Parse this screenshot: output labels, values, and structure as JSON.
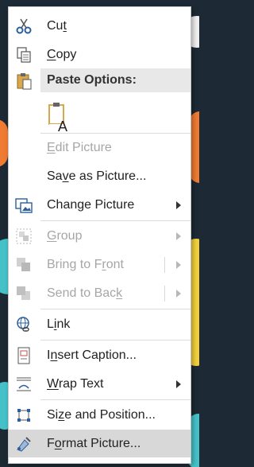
{
  "menu": {
    "items": [
      {
        "pre": "Cu",
        "ul": "t",
        "post": ""
      },
      {
        "pre": "",
        "ul": "C",
        "post": "opy"
      },
      {
        "header": "Paste Options:"
      },
      {
        "pre": "",
        "ul": "E",
        "post": "dit Picture"
      },
      {
        "pre": "Sa",
        "ul": "v",
        "post": "e as Picture..."
      },
      {
        "pre": "Change Picture",
        "ul": "",
        "post": ""
      },
      {
        "pre": "",
        "ul": "G",
        "post": "roup"
      },
      {
        "pre": "Bring to F",
        "ul": "r",
        "post": "ont"
      },
      {
        "pre": "Send to Bac",
        "ul": "k",
        "post": ""
      },
      {
        "pre": "L",
        "ul": "i",
        "post": "nk"
      },
      {
        "pre": "I",
        "ul": "n",
        "post": "sert Caption..."
      },
      {
        "pre": "",
        "ul": "W",
        "post": "rap Text"
      },
      {
        "pre": "Si",
        "ul": "z",
        "post": "e and Position..."
      },
      {
        "pre": "F",
        "ul": "o",
        "post": "rmat Picture..."
      }
    ],
    "paste_glyph": "A"
  }
}
